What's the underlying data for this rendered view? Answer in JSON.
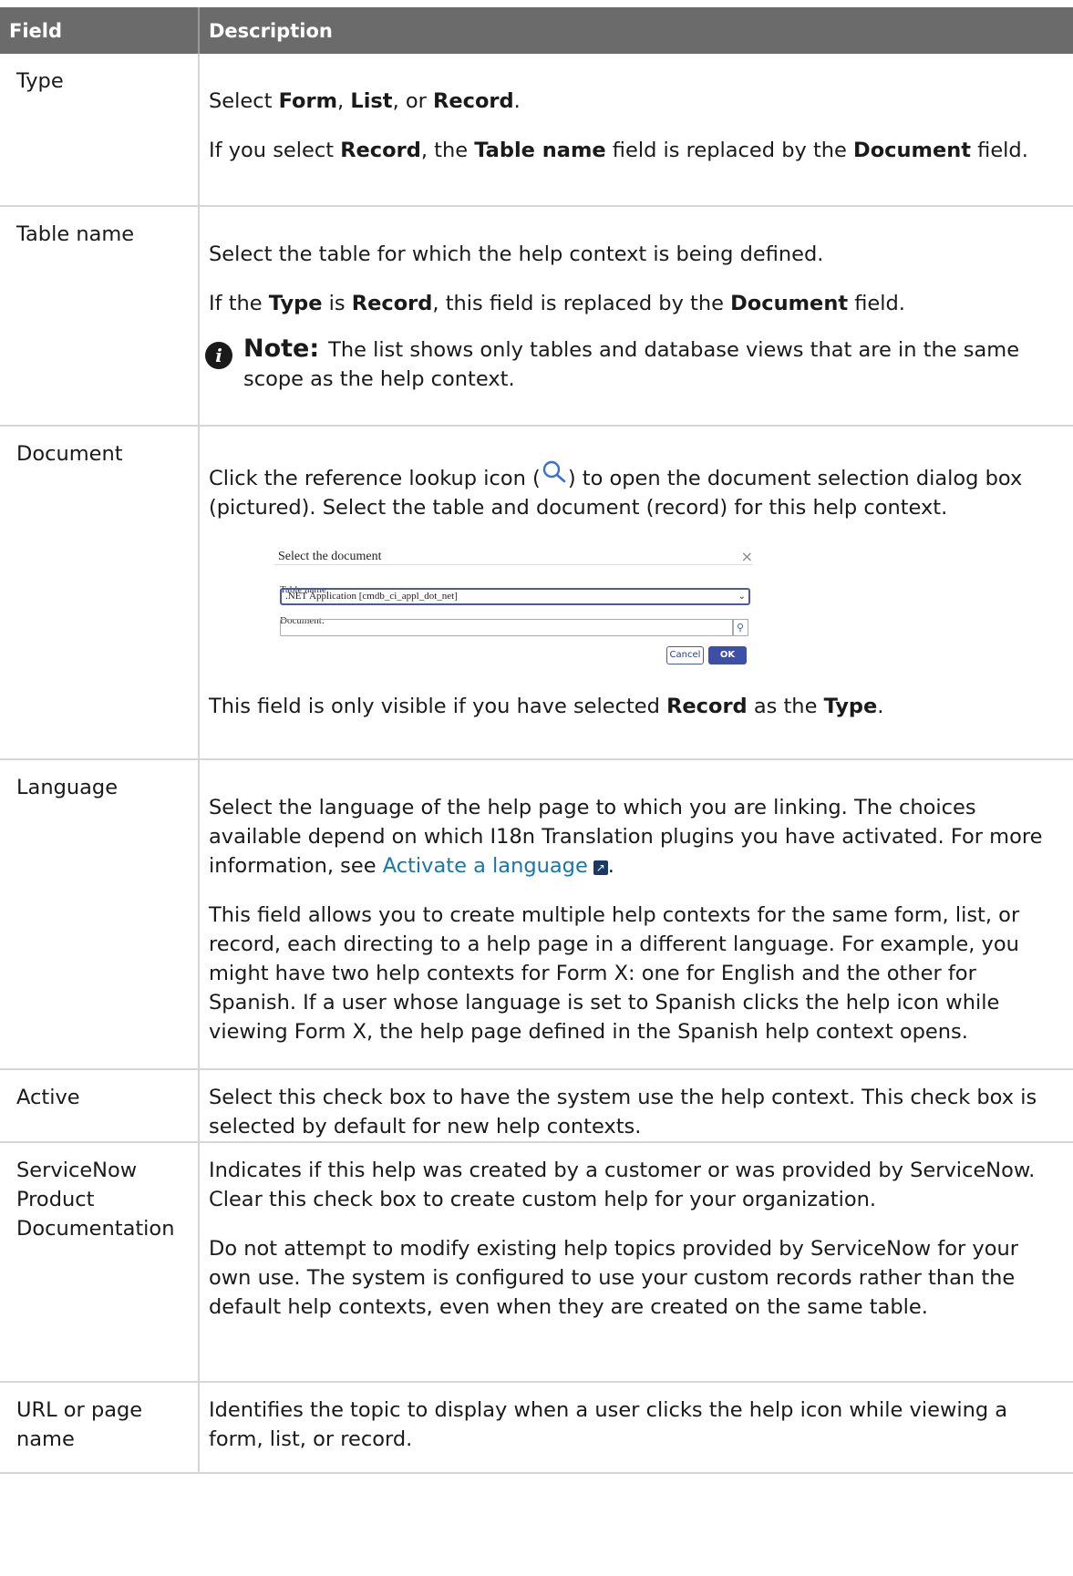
{
  "header": {
    "field": "Field",
    "description": "Description"
  },
  "rows": {
    "type": {
      "field": "Type",
      "p1": [
        "Select ",
        "Form",
        ", ",
        "List",
        ", or ",
        "Record",
        "."
      ],
      "p2": [
        "If you select ",
        "Record",
        ", the ",
        "Table name",
        " field is replaced by the ",
        "Document",
        " field."
      ]
    },
    "table_name": {
      "field": "Table name",
      "p1": "Select the table for which the help context is being defined.",
      "p2": [
        "If the ",
        "Type",
        " is ",
        "Record",
        ", this field is replaced by the ",
        "Document",
        " field."
      ],
      "note_label": "Note:",
      "note_text": "The list shows only tables and database views that are in the same scope as the help context."
    },
    "document": {
      "field": "Document",
      "p1a": "Click the reference lookup icon (",
      "p1b": ") to open the document selection dialog box (pictured). Select the table and document (record) for this help context.",
      "dialog": {
        "title": "Select the document",
        "table_label": "Table name:",
        "table_value": ".NET Application [cmdb_ci_appl_dot_net]",
        "doc_label": "Document:",
        "cancel": "Cancel",
        "ok": "OK"
      },
      "p2": [
        "This field is only visible if you have selected ",
        "Record",
        " as the ",
        "Type",
        "."
      ]
    },
    "language": {
      "field": "Language",
      "p1": "Select the language of the help page to which you are linking. The choices available depend on which I18n Translation plugins you have activated. For more information, see ",
      "link": "Activate a language",
      "p2": "This field allows you to create multiple help contexts for the same form, list, or record, each directing to a help page in a different language. For example, you might have two help contexts for Form X: one for English and the other for Spanish. If a user whose language is set to Spanish clicks the help icon while viewing Form X, the help page defined in the Spanish help context opens."
    },
    "active": {
      "field": "Active",
      "p1": "Select this check box to have the system use the help context. This check box is selected by default for new help contexts."
    },
    "servicenow": {
      "field": "ServiceNow Product Documentation",
      "p1": "Indicates if this help was created by a customer or was provided by ServiceNow. Clear this check box to create custom help for your organization.",
      "p2": "Do not attempt to modify existing help topics provided by ServiceNow for your own use. The system is configured to use your custom records rather than the default help contexts, even when they are created on the same table."
    },
    "url": {
      "field": "URL or page name",
      "p1": "Identifies the topic to display when a user clicks the help icon while viewing a form, list, or record."
    }
  }
}
